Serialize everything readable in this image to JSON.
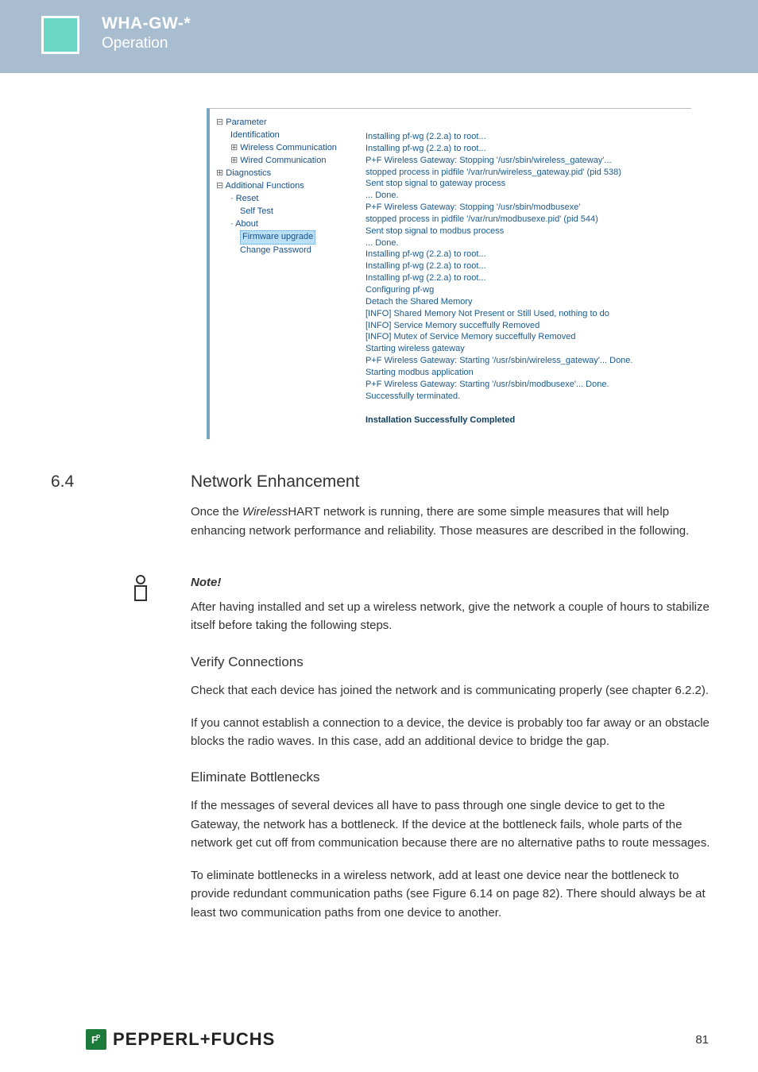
{
  "header": {
    "title": "WHA-GW-*",
    "subtitle": "Operation"
  },
  "tree": {
    "n0": "Parameter",
    "n1": "Identification",
    "n2": "Wireless Communication",
    "n3": "Wired Communication",
    "n4": "Diagnostics",
    "n5": "Additional Functions",
    "n6": "Reset",
    "n7": "Self Test",
    "n8": "About",
    "n9": "Firmware upgrade",
    "n10": "Change Password"
  },
  "log": {
    "l0": "Installing pf-wg (2.2.a) to root...",
    "l1": "Installing pf-wg (2.2.a) to root...",
    "l2": "P+F Wireless Gateway: Stopping '/usr/sbin/wireless_gateway'...",
    "l3": "stopped process in pidfile '/var/run/wireless_gateway.pid' (pid 538)",
    "l4": "Sent stop signal to gateway process",
    "l5": "... Done.",
    "l6": "P+F Wireless Gateway: Stopping '/usr/sbin/modbusexe'",
    "l7": "stopped process in pidfile '/var/run/modbusexe.pid' (pid 544)",
    "l8": "Sent stop signal to modbus process",
    "l9": "... Done.",
    "l10": "Installing pf-wg (2.2.a) to root...",
    "l11": "Installing pf-wg (2.2.a) to root...",
    "l12": "Installing pf-wg (2.2.a) to root...",
    "l13": "Configuring pf-wg",
    "l14": "Detach the Shared Memory",
    "l15": "[INFO] Shared Memory Not Present or Still Used, nothing to do",
    "l16": "[INFO] Service Memory succeffully Removed",
    "l17": "[INFO] Mutex of Service Memory succeffully Removed",
    "l18": "Starting wireless gateway",
    "l19": "P+F Wireless Gateway: Starting '/usr/sbin/wireless_gateway'... Done.",
    "l20": "Starting modbus application",
    "l21": "P+F Wireless Gateway: Starting '/usr/sbin/modbusexe'... Done.",
    "l22": "Successfully terminated.",
    "done": "Installation Successfully Completed"
  },
  "section": {
    "num": "6.4",
    "title": "Network Enhancement"
  },
  "para": {
    "p1a": "Once the ",
    "p1b": "Wireless",
    "p1c": "HART network is running, there are some simple measures that will help enhancing network performance and reliability. Those measures are described in the following."
  },
  "note": {
    "label": "Note!",
    "text": "After having installed and set up a wireless network, give the network a couple of hours to stabilize itself before taking the following steps."
  },
  "verify": {
    "head": "Verify Connections",
    "p1": "Check that each device has joined the network and is communicating properly (see chapter 6.2.2).",
    "p2": "If you cannot establish a connection to a device, the device is probably too far away or an obstacle blocks the radio waves. In this case, add an additional device to bridge the gap."
  },
  "bottle": {
    "head": "Eliminate Bottlenecks",
    "p1": "If the messages of several devices all have to pass through one single device to get to the Gateway, the network has a bottleneck. If the device at the bottleneck fails, whole parts of the network get cut off from communication because there are no alternative paths to route messages.",
    "p2": "To eliminate bottlenecks in a wireless network, add at least one device near the bottleneck to provide redundant communication paths (see Figure 6.14 on page 82). There should always be at least two communication paths from one device to another."
  },
  "footer": {
    "brand": "PEPPERL+FUCHS",
    "page": "81"
  }
}
